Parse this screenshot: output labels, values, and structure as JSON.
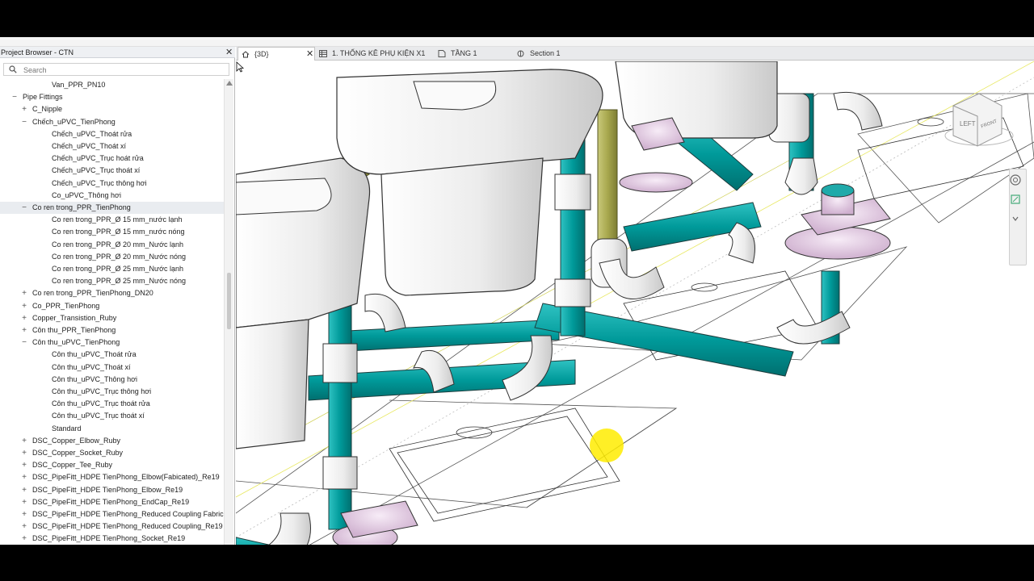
{
  "project_browser": {
    "title": "Project Browser - CTN",
    "search_placeholder": "Search",
    "items": [
      {
        "label": "Van_PPR_PN10",
        "level": 3,
        "toggle": ""
      },
      {
        "label": "Pipe Fittings",
        "level": 1,
        "toggle": "-"
      },
      {
        "label": "C_Nipple",
        "level": 2,
        "toggle": "+"
      },
      {
        "label": "Chếch_uPVC_TienPhong",
        "level": 2,
        "toggle": "-"
      },
      {
        "label": "Chếch_uPVC_Thoát rửa",
        "level": 3,
        "toggle": ""
      },
      {
        "label": "Chếch_uPVC_Thoát xí",
        "level": 3,
        "toggle": ""
      },
      {
        "label": "Chếch_uPVC_Trục hoát rửa",
        "level": 3,
        "toggle": ""
      },
      {
        "label": "Chếch_uPVC_Trục thoát xí",
        "level": 3,
        "toggle": ""
      },
      {
        "label": "Chếch_uPVC_Trục thông hơi",
        "level": 3,
        "toggle": ""
      },
      {
        "label": "Co_uPVC_Thông hơi",
        "level": 3,
        "toggle": ""
      },
      {
        "label": "Co ren trong_PPR_TienPhong",
        "level": 2,
        "toggle": "-",
        "selected": true
      },
      {
        "label": "Co ren trong_PPR_Ø 15 mm_nước lạnh",
        "level": 3,
        "toggle": ""
      },
      {
        "label": "Co ren trong_PPR_Ø 15 mm_nước nóng",
        "level": 3,
        "toggle": ""
      },
      {
        "label": "Co ren trong_PPR_Ø 20 mm_Nước lạnh",
        "level": 3,
        "toggle": ""
      },
      {
        "label": "Co ren trong_PPR_Ø 20 mm_Nước nóng",
        "level": 3,
        "toggle": ""
      },
      {
        "label": "Co ren trong_PPR_Ø 25 mm_Nước lạnh",
        "level": 3,
        "toggle": ""
      },
      {
        "label": "Co ren trong_PPR_Ø 25 mm_Nước nóng",
        "level": 3,
        "toggle": ""
      },
      {
        "label": "Co ren trong_PPR_TienPhong_DN20",
        "level": 2,
        "toggle": "+"
      },
      {
        "label": "Co_PPR_TienPhong",
        "level": 2,
        "toggle": "+"
      },
      {
        "label": "Copper_Transistion_Ruby",
        "level": 2,
        "toggle": "+"
      },
      {
        "label": "Côn thu_PPR_TienPhong",
        "level": 2,
        "toggle": "+"
      },
      {
        "label": "Côn thu_uPVC_TienPhong",
        "level": 2,
        "toggle": "-"
      },
      {
        "label": "Côn thu_uPVC_Thoát rửa",
        "level": 3,
        "toggle": ""
      },
      {
        "label": "Côn thu_uPVC_Thoát xí",
        "level": 3,
        "toggle": ""
      },
      {
        "label": "Côn thu_uPVC_Thông hơi",
        "level": 3,
        "toggle": ""
      },
      {
        "label": "Côn thu_uPVC_Trục thông hơi",
        "level": 3,
        "toggle": ""
      },
      {
        "label": "Côn thu_uPVC_Trục thoát rửa",
        "level": 3,
        "toggle": ""
      },
      {
        "label": "Côn thu_uPVC_Trục thoát xí",
        "level": 3,
        "toggle": ""
      },
      {
        "label": "Standard",
        "level": 3,
        "toggle": ""
      },
      {
        "label": "DSC_Copper_Elbow_Ruby",
        "level": 2,
        "toggle": "+"
      },
      {
        "label": "DSC_Copper_Socket_Ruby",
        "level": 2,
        "toggle": "+"
      },
      {
        "label": "DSC_Copper_Tee_Ruby",
        "level": 2,
        "toggle": "+"
      },
      {
        "label": "DSC_PipeFitt_HDPE TienPhong_Elbow(Fabicated)_Re19",
        "level": 2,
        "toggle": "+"
      },
      {
        "label": "DSC_PipeFitt_HDPE TienPhong_Elbow_Re19",
        "level": 2,
        "toggle": "+"
      },
      {
        "label": "DSC_PipeFitt_HDPE TienPhong_EndCap_Re19",
        "level": 2,
        "toggle": "+"
      },
      {
        "label": "DSC_PipeFitt_HDPE TienPhong_Reduced Coupling Fabricate",
        "level": 2,
        "toggle": "+"
      },
      {
        "label": "DSC_PipeFitt_HDPE TienPhong_Reduced Coupling_Re19",
        "level": 2,
        "toggle": "+"
      },
      {
        "label": "DSC_PipeFitt_HDPE TienPhong_Socket_Re19",
        "level": 2,
        "toggle": "+"
      }
    ]
  },
  "tabs": [
    {
      "label": "{3D}",
      "icon": "home-icon",
      "active": true,
      "closable": true
    },
    {
      "label": "1. THỐNG KÊ PHỤ KIỆN X1",
      "icon": "schedule-icon",
      "active": false,
      "closable": false
    },
    {
      "label": "TẦNG 1",
      "icon": "floor-plan-icon",
      "active": false,
      "closable": false
    },
    {
      "label": "Section 1",
      "icon": "section-icon",
      "active": false,
      "closable": false
    }
  ],
  "viewcube": {
    "face_left": "LEFT",
    "face_front": "FRONT"
  },
  "colors": {
    "pipe_teal": "#009a9a",
    "fitting_white": "#f2f2f2",
    "vent_olive": "#a8a84e",
    "drain_pink": "#e6cfe6",
    "cursor_yellow": "#ffea00"
  }
}
